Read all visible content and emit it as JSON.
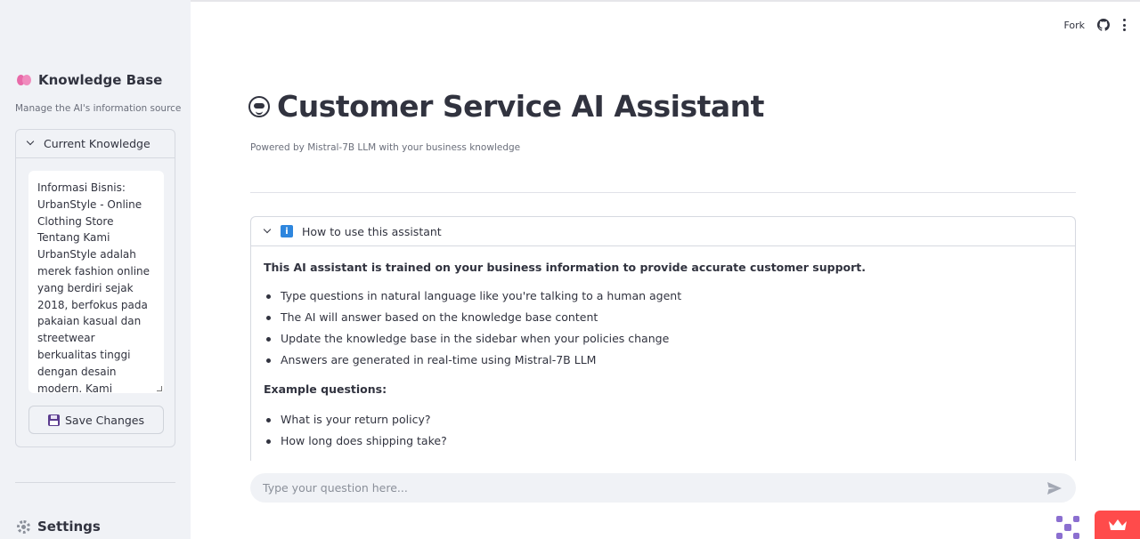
{
  "sidebar": {
    "title": "Knowledge Base",
    "caption": "Manage the AI's information source",
    "expander_label": "Current Knowledge",
    "knowledge_text": "Informasi Bisnis:\nUrbanStyle - Online Clothing Store\nTentang Kami\nUrbanStyle adalah merek fashion online yang berdiri sejak 2018, berfokus pada pakaian kasual dan streetwear berkualitas tinggi dengan desain modern. Kami",
    "save_label": "Save Changes",
    "settings_title": "Settings"
  },
  "toolbar": {
    "fork_label": "Fork"
  },
  "main": {
    "title": "Customer Service AI Assistant",
    "caption": "Powered by Mistral-7B LLM with your business knowledge",
    "help": {
      "label": "How to use this assistant",
      "intro": "This AI assistant is trained on your business information to provide accurate customer support.",
      "bullets": [
        "Type questions in natural language like you're talking to a human agent",
        "The AI will answer based on the knowledge base content",
        "Update the knowledge base in the sidebar when your policies change",
        "Answers are generated in real-time using Mistral-7B LLM"
      ],
      "examples_label": "Example questions:",
      "examples": [
        "What is your return policy?",
        "How long does shipping take?"
      ]
    }
  },
  "chat": {
    "placeholder": "Type your question here..."
  },
  "colors": {
    "accent": "#ff4b4b",
    "sidebar_bg": "#f0f2f6",
    "text": "#31333f"
  }
}
